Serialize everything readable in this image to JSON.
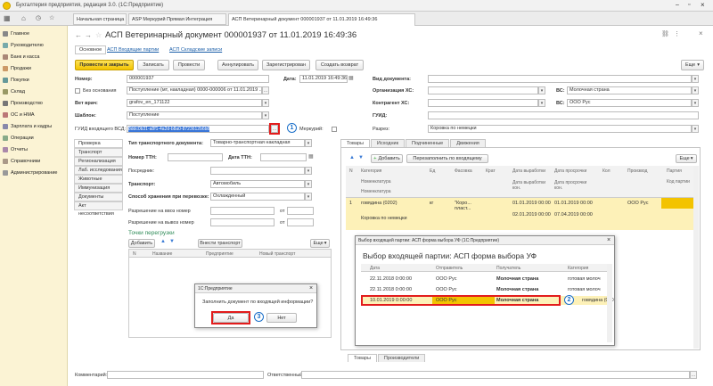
{
  "window": {
    "title": "Бухгалтерия предприятия, редакция 3.0. (1С:Предприятие)"
  },
  "topbar": {
    "tabs": [
      "Начальная страница",
      "ASP Меркурий Прямая Интеграция",
      "АСП Ветеринарный документ 000001937 от 11.01.2019 16:49:36"
    ]
  },
  "sidebar": {
    "items": [
      "Главное",
      "Руководителю",
      "Банк и касса",
      "Продажи",
      "Покупки",
      "Склад",
      "Производство",
      "ОС и НМА",
      "Зарплата и кадры",
      "Операции",
      "Отчеты",
      "Справочники",
      "Администрирование"
    ]
  },
  "doc": {
    "title": "АСП Ветеринарный документ 000001937 от 11.01.2019 16:49:36",
    "subtabs": [
      "Основное",
      "АСП Входящие партии",
      "АСП Складские записи"
    ],
    "toolbar": {
      "post_close": "Провести и закрыть",
      "save": "Записать",
      "post": "Провести",
      "cancel": "Аннулировать",
      "registered": "Зарегистрирован",
      "create_return": "Создать возврат",
      "more": "Еще"
    },
    "fields": {
      "number_label": "Номер:",
      "number_value": "000001937",
      "date_label": "Дата:",
      "date_value": "11.01.2019 16:49:36",
      "no_base_label": "Без основания",
      "base_value": "Поступление (мт, накладная) 0000-000006 от 11.01.2019 ...",
      "vet_label": "Вет врач:",
      "vet_value": "grafov_en_171122",
      "template_label": "Шаблон:",
      "template_value": "Поступление",
      "guid_in_label": "ГУИД входящего ВСД:",
      "guid_in_value": "8ddc0b31-a8f1-4a2d-b8a0-8723612b6b8",
      "mark_label": "Меркурий:",
      "doctype_label": "Вид документа:",
      "org_label": "Организация ХС:",
      "vs_label": "ВС:",
      "org_vs_value": "Молочная страна",
      "contr_label": "Контрагент ХС:",
      "contr_vs_value": "ООО Рус",
      "guid_label": "ГУИД:",
      "razr_label": "Разрез:",
      "razr_value": "Коровка по немецки"
    },
    "left_vtabs": [
      "Проверка",
      "Транспорт",
      "Регионализация",
      "Лаб. исследования",
      "Животные",
      "Иммунизация",
      "Документы",
      "Акт несоответствия"
    ],
    "transport": {
      "type_label": "Тип транспортного документа:",
      "type_value": "Товарно-транспортная накладная",
      "ttn_label": "Номер ТТН:",
      "ttn_date_label": "Дата ТТН:",
      "posrednik_label": "Посредник:",
      "transport_label": "Транспорт:",
      "transport_value": "Автомобиль",
      "storage_label": "Способ хранения при перевозке:",
      "storage_value": "Охлажденный",
      "perm_in_label": "Разрешение на ввоз номер",
      "perm_out_label": "Разрешение на вывоз номер",
      "from_label": "от",
      "reload_title": "Точки перегрузки",
      "add": "Добавить",
      "insert": "Внести транспорт",
      "more": "Еще",
      "cols": [
        "N",
        "Название",
        "Предприятие",
        "Новый транспорт"
      ]
    },
    "right_tabs": [
      "Товары",
      "Исходник",
      "Подчиненные",
      "Движения"
    ],
    "goods": {
      "add": "Добавить",
      "fill": "Перезаполнить по входящему",
      "more": "Еще",
      "cols": [
        "N",
        "Категория",
        "Ед",
        "Фасовка",
        "Крат",
        "Дата выработки",
        "Дата просрочки",
        "Кол",
        "Производ",
        "Партия"
      ],
      "subcols": [
        "Номенклатура",
        "Номенклатура",
        "Дата выработки кон.",
        "Дата просрочки кон.",
        "Код партии"
      ],
      "row": {
        "n": "1",
        "cat": "говядина (0202)",
        "unit": "кг",
        "pack": "\"Коро... пласт...",
        "date1": "01.01.2019 00:00",
        "date2": "01.01.2019 00:00",
        "date3": "02.01.2019 00:00",
        "date4": "07.04.2019 00:00",
        "prod": "ООО Рус",
        "nom": "Коровка по немецки"
      }
    },
    "bottom_tabs": [
      "Товары",
      "Производители"
    ],
    "comment_label": "Комментарий:",
    "responsible_label": "Ответственный:"
  },
  "dialog_party": {
    "title": "Выбор входящей партии: АСП форма выбора УФ (1С:Предприятие)",
    "header": "Выбор входящей партии: АСП форма выбора УФ",
    "cols": [
      "Дата",
      "Отправитель",
      "Получатель",
      "Категория"
    ],
    "rows": [
      {
        "date": "22.11.2018 0:00:00",
        "sender": "ООО Рус",
        "recv": "Молочная страна",
        "cat": "готовая молоч"
      },
      {
        "date": "22.11.2018 0:00:00",
        "sender": "ООО Рус",
        "recv": "Молочная страна",
        "cat": "готовая молоч"
      },
      {
        "date": "10.01.2019 0:00:00",
        "sender": "ООО Рус",
        "recv": "Молочная страна",
        "cat": "говядина (020"
      }
    ]
  },
  "dialog_confirm": {
    "title": "1С:Предприятие",
    "question": "Заполнить документ по входящей информации?",
    "yes": "Да",
    "no": "Нет"
  },
  "badges": [
    "1",
    "2",
    "3"
  ],
  "colors": {
    "accent": "#f3c300",
    "highlight_row": "#fdf1b8",
    "annotation": "#e21c1c",
    "badge": "#1a6fc9"
  }
}
